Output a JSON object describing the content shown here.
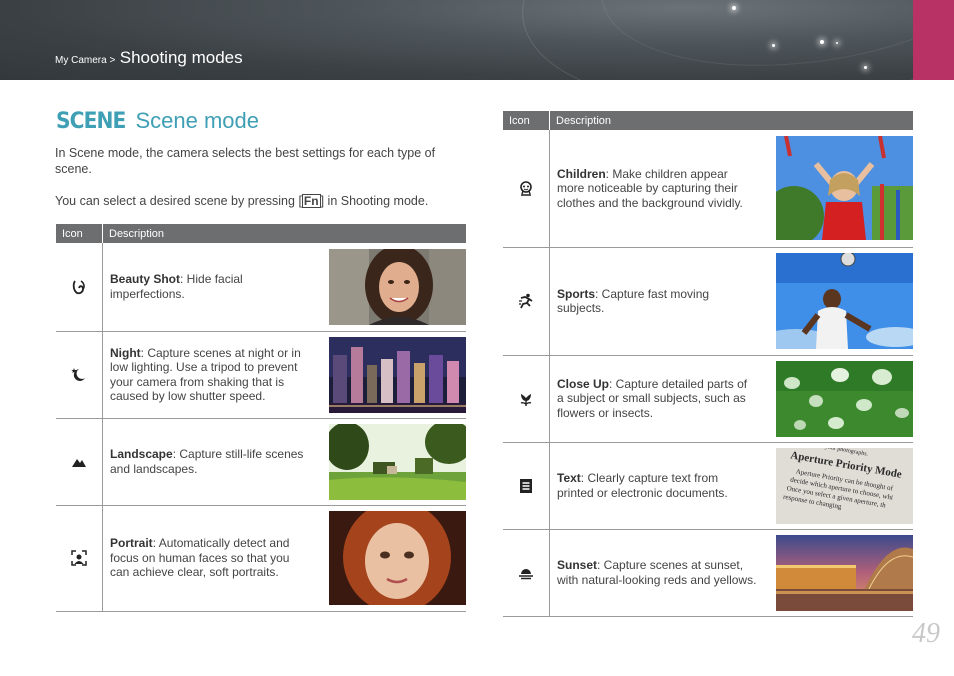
{
  "header": {
    "breadcrumb_parent": "My Camera >",
    "breadcrumb_current": "Shooting modes",
    "accent_color": "#b83266"
  },
  "title": {
    "icon_text": "SCENE",
    "text": "Scene mode",
    "color": "#3f9fb4"
  },
  "intro": {
    "p1": "In Scene mode, the camera selects the best settings for each type of scene.",
    "p2_before": "You can select a desired scene by pressing [",
    "p2_key": "Fn",
    "p2_after": "] in Shooting mode."
  },
  "left_table": {
    "headers": [
      "Icon",
      "Description"
    ],
    "rows": [
      {
        "icon": "beauty-shot-icon",
        "name": "Beauty Shot",
        "desc": ": Hide facial imperfections.",
        "photo": "smiling-woman-photo"
      },
      {
        "icon": "night-icon",
        "name": "Night",
        "desc": ": Capture scenes at night or in low lighting. Use a tripod to prevent your camera from shaking that is caused by low shutter speed.",
        "photo": "city-night-photo"
      },
      {
        "icon": "landscape-icon",
        "name": "Landscape",
        "desc": ": Capture still-life scenes and landscapes.",
        "photo": "park-landscape-photo"
      },
      {
        "icon": "portrait-icon",
        "name": "Portrait",
        "desc": ": Automatically detect and focus on human faces so that you can achieve clear, soft portraits.",
        "photo": "girl-portrait-photo"
      }
    ]
  },
  "right_table": {
    "headers": [
      "Icon",
      "Description"
    ],
    "rows": [
      {
        "icon": "children-icon",
        "name": "Children",
        "desc": ": Make children appear more noticeable by capturing their clothes and the background vividly.",
        "photo": "child-playground-photo"
      },
      {
        "icon": "sports-icon",
        "name": "Sports",
        "desc": ": Capture fast moving subjects.",
        "photo": "soccer-player-photo"
      },
      {
        "icon": "close-up-icon",
        "name": "Close Up",
        "desc": ": Capture detailed parts of a subject or small subjects, such as flowers or insects.",
        "photo": "water-drops-photo"
      },
      {
        "icon": "text-icon",
        "name": "Text",
        "desc": ": Clearly capture text from printed or electronic documents.",
        "photo": "printed-text-photo"
      },
      {
        "icon": "sunset-icon",
        "name": "Sunset",
        "desc": ": Capture scenes at sunset, with natural-looking reds and yellows.",
        "photo": "sunset-building-photo"
      }
    ]
  },
  "text_photo_lines": [
    "of your photographs.",
    "Aperture Priority Mode",
    "Aperture Priority can be thought of",
    "decide which aperture to choose, whi",
    "Once you select a given aperture, th",
    "response to changing"
  ],
  "page_number": "49"
}
